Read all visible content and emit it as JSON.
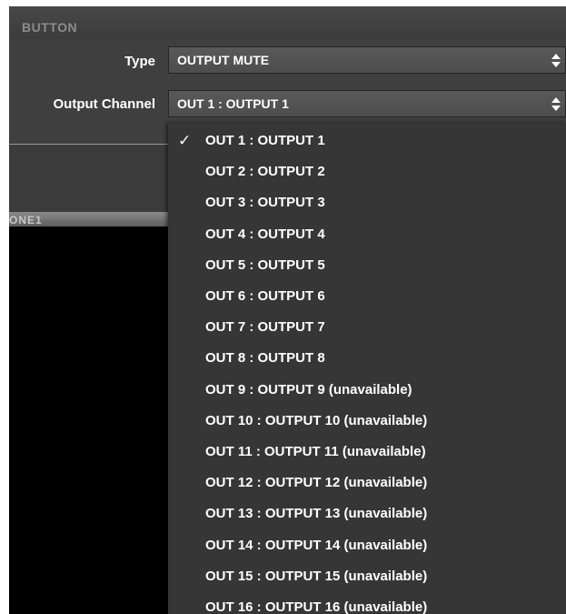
{
  "section": {
    "title": "BUTTON"
  },
  "type_field": {
    "label": "Type",
    "value": "OUTPUT MUTE"
  },
  "channel_field": {
    "label": "Output Channel",
    "value": "OUT 1 : OUTPUT 1"
  },
  "panel": {
    "label": "ONE1"
  },
  "dropdown": {
    "selected_index": 0,
    "check_glyph": "✓",
    "options": [
      "OUT 1 : OUTPUT 1",
      "OUT 2 : OUTPUT 2",
      "OUT 3 : OUTPUT 3",
      "OUT 4 : OUTPUT 4",
      "OUT 5 : OUTPUT 5",
      "OUT 6 : OUTPUT 6",
      "OUT 7 : OUTPUT 7",
      "OUT 8 : OUTPUT 8",
      "OUT 9 : OUTPUT 9 (unavailable)",
      "OUT 10 : OUTPUT 10 (unavailable)",
      "OUT 11 : OUTPUT 11 (unavailable)",
      "OUT 12 : OUTPUT 12 (unavailable)",
      "OUT 13 : OUTPUT 13 (unavailable)",
      "OUT 14 : OUTPUT 14 (unavailable)",
      "OUT 15 : OUTPUT 15 (unavailable)",
      "OUT 16 : OUTPUT 16 (unavailable)"
    ]
  },
  "icons": {
    "stepper": "up-down-stepper-icon",
    "check": "checkmark-icon"
  },
  "colors": {
    "panel_bg": "#3f3f3f",
    "menu_bg": "#363636",
    "text": "#ffffff",
    "header_text": "#8d8d8d"
  }
}
